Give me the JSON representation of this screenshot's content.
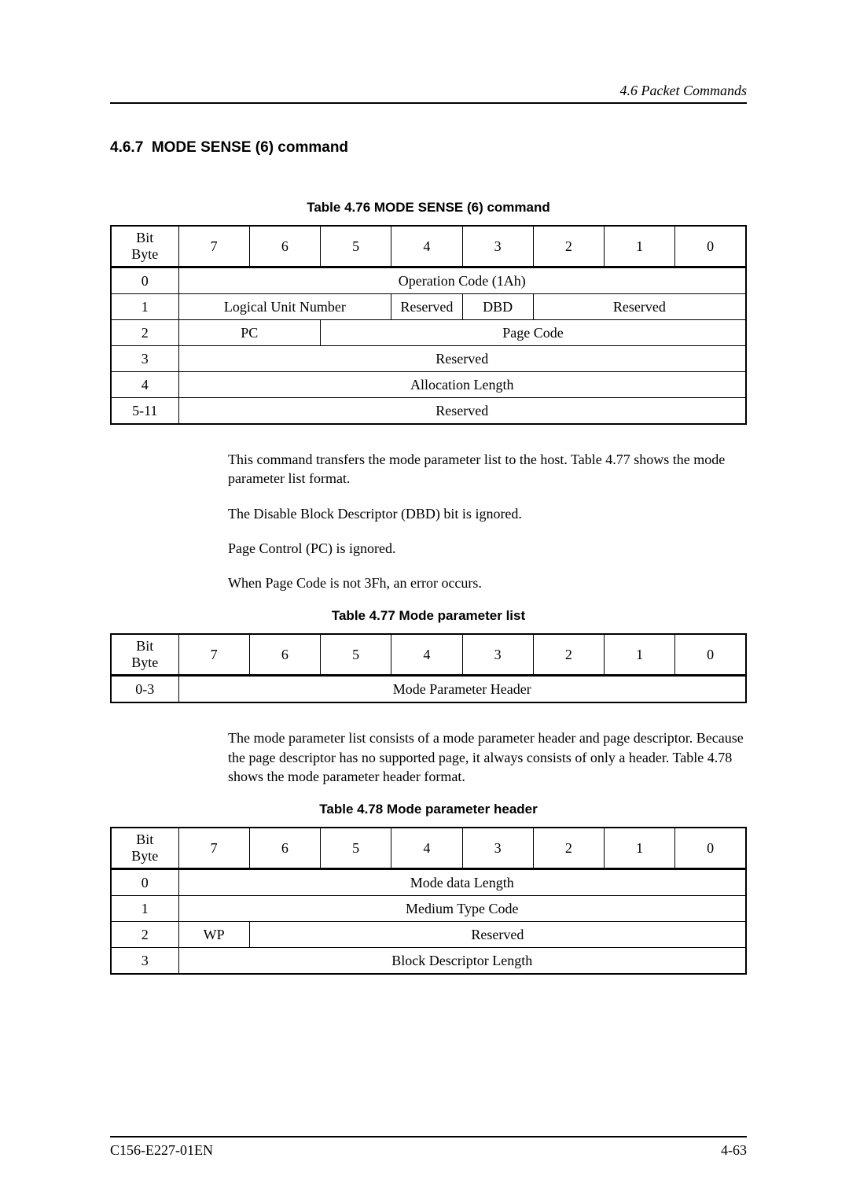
{
  "header": {
    "section_ref": "4.6  Packet Commands"
  },
  "section": {
    "number": "4.6.7",
    "title": "MODE SENSE (6) command"
  },
  "table76": {
    "caption": "Table 4.76 MODE SENSE (6) command",
    "header_label": "Bit\nByte",
    "bits": [
      "7",
      "6",
      "5",
      "4",
      "3",
      "2",
      "1",
      "0"
    ],
    "rows": {
      "r0_byte": "0",
      "r0_span": "Operation Code (1Ah)",
      "r1_byte": "1",
      "r1_lun": "Logical Unit Number",
      "r1_resv1": "Reserved",
      "r1_dbd": "DBD",
      "r1_resv2": "Reserved",
      "r2_byte": "2",
      "r2_pc": "PC",
      "r2_pagecode": "Page Code",
      "r3_byte": "3",
      "r3_resv": "Reserved",
      "r4_byte": "4",
      "r4_alloc": "Allocation Length",
      "r5_byte": "5-11",
      "r5_resv": "Reserved"
    }
  },
  "para1": "This command transfers the mode parameter list to the host.  Table 4.77 shows the mode parameter list format.",
  "para2": "The Disable Block Descriptor (DBD) bit is ignored.",
  "para3": "Page Control (PC) is ignored.",
  "para4": "When Page Code is not 3Fh, an error occurs.",
  "table77": {
    "caption": "Table 4.77 Mode parameter list",
    "header_label": "Bit\nByte",
    "bits": [
      "7",
      "6",
      "5",
      "4",
      "3",
      "2",
      "1",
      "0"
    ],
    "row_byte": "0-3",
    "row_content": "Mode Parameter Header"
  },
  "para5": "The mode parameter list consists of a mode parameter header and page descriptor.  Because the page descriptor has no supported page, it always consists of only a header.  Table 4.78 shows the mode parameter header format.",
  "table78": {
    "caption": "Table 4.78 Mode parameter header",
    "header_label": "Bit\nByte",
    "bits": [
      "7",
      "6",
      "5",
      "4",
      "3",
      "2",
      "1",
      "0"
    ],
    "r0_byte": "0",
    "r0_content": "Mode data Length",
    "r1_byte": "1",
    "r1_content": "Medium Type Code",
    "r2_byte": "2",
    "r2_wp": "WP",
    "r2_resv": "Reserved",
    "r3_byte": "3",
    "r3_content": "Block Descriptor Length"
  },
  "footer": {
    "doc_id": "C156-E227-01EN",
    "page_num": "4-63"
  }
}
